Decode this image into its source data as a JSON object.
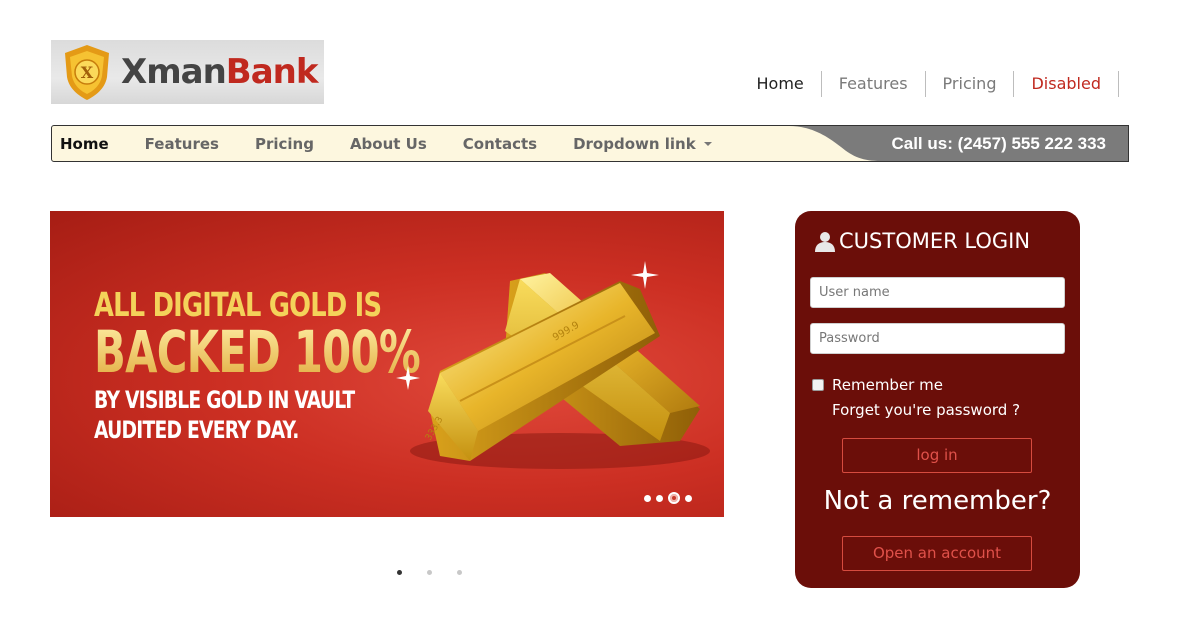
{
  "logo": {
    "brand_first": "Xman",
    "brand_second": "Bank",
    "emblem_letter": "X"
  },
  "topnav": [
    {
      "label": "Home"
    },
    {
      "label": "Features"
    },
    {
      "label": "Pricing"
    },
    {
      "label": "Disabled"
    }
  ],
  "navbar": {
    "items": [
      {
        "label": "Home"
      },
      {
        "label": "Features"
      },
      {
        "label": "Pricing"
      },
      {
        "label": "About Us"
      },
      {
        "label": "Contacts"
      },
      {
        "label": "Dropdown link"
      }
    ],
    "callus": "Call us: (2457) 555 222 333"
  },
  "banner": {
    "line1": "ALL DIGITAL GOLD IS",
    "line2": "BACKED 100%",
    "line3": "BY VISIBLE GOLD IN VAULT",
    "line4": "AUDITED EVERY DAY.",
    "slides": 4,
    "active_slide": 3
  },
  "carousel": {
    "pages": 3,
    "active_page": 1
  },
  "login": {
    "title": "CUSTOMER LOGIN",
    "username_placeholder": "User name",
    "password_placeholder": "Password",
    "remember_label": "Remember me",
    "forgot_label": "Forget you're password ?",
    "login_button": "log in",
    "not_member": "Not a remember?",
    "open_account_button": "Open an account"
  },
  "colors": {
    "brand_red": "#c0291f",
    "login_bg": "#6b0e09",
    "navbar_bg": "#fdf7df",
    "callus_bg": "#7b7b7b"
  }
}
